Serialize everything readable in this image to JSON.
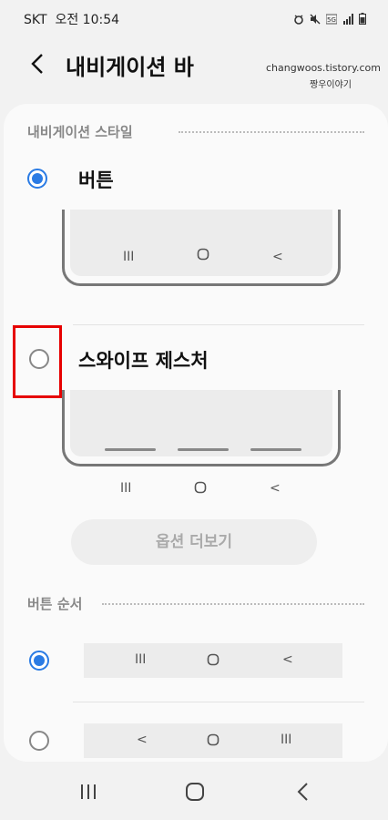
{
  "status": {
    "carrier": "SKT",
    "time": "오전 10:54"
  },
  "header": {
    "title": "내비게이션 바"
  },
  "watermark": {
    "site": "changwoos.tistory.com",
    "author": "짱우이야기"
  },
  "nav_style": {
    "heading": "내비게이션 스타일",
    "options": [
      {
        "label": "버튼",
        "selected": true
      },
      {
        "label": "스와이프 제스처",
        "selected": false
      }
    ]
  },
  "more_options_label": "옵션 더보기",
  "button_order": {
    "heading": "버튼 순서",
    "options": [
      {
        "selected": true,
        "icons": [
          "recents-icon",
          "home-icon",
          "back-icon"
        ]
      },
      {
        "selected": false,
        "icons": [
          "back-icon",
          "home-icon",
          "recents-icon"
        ]
      }
    ]
  },
  "glyphs": {
    "recents": "III",
    "home": "O",
    "back": "<"
  },
  "colors": {
    "accent": "#2a7be4",
    "highlight": "#e60000"
  }
}
